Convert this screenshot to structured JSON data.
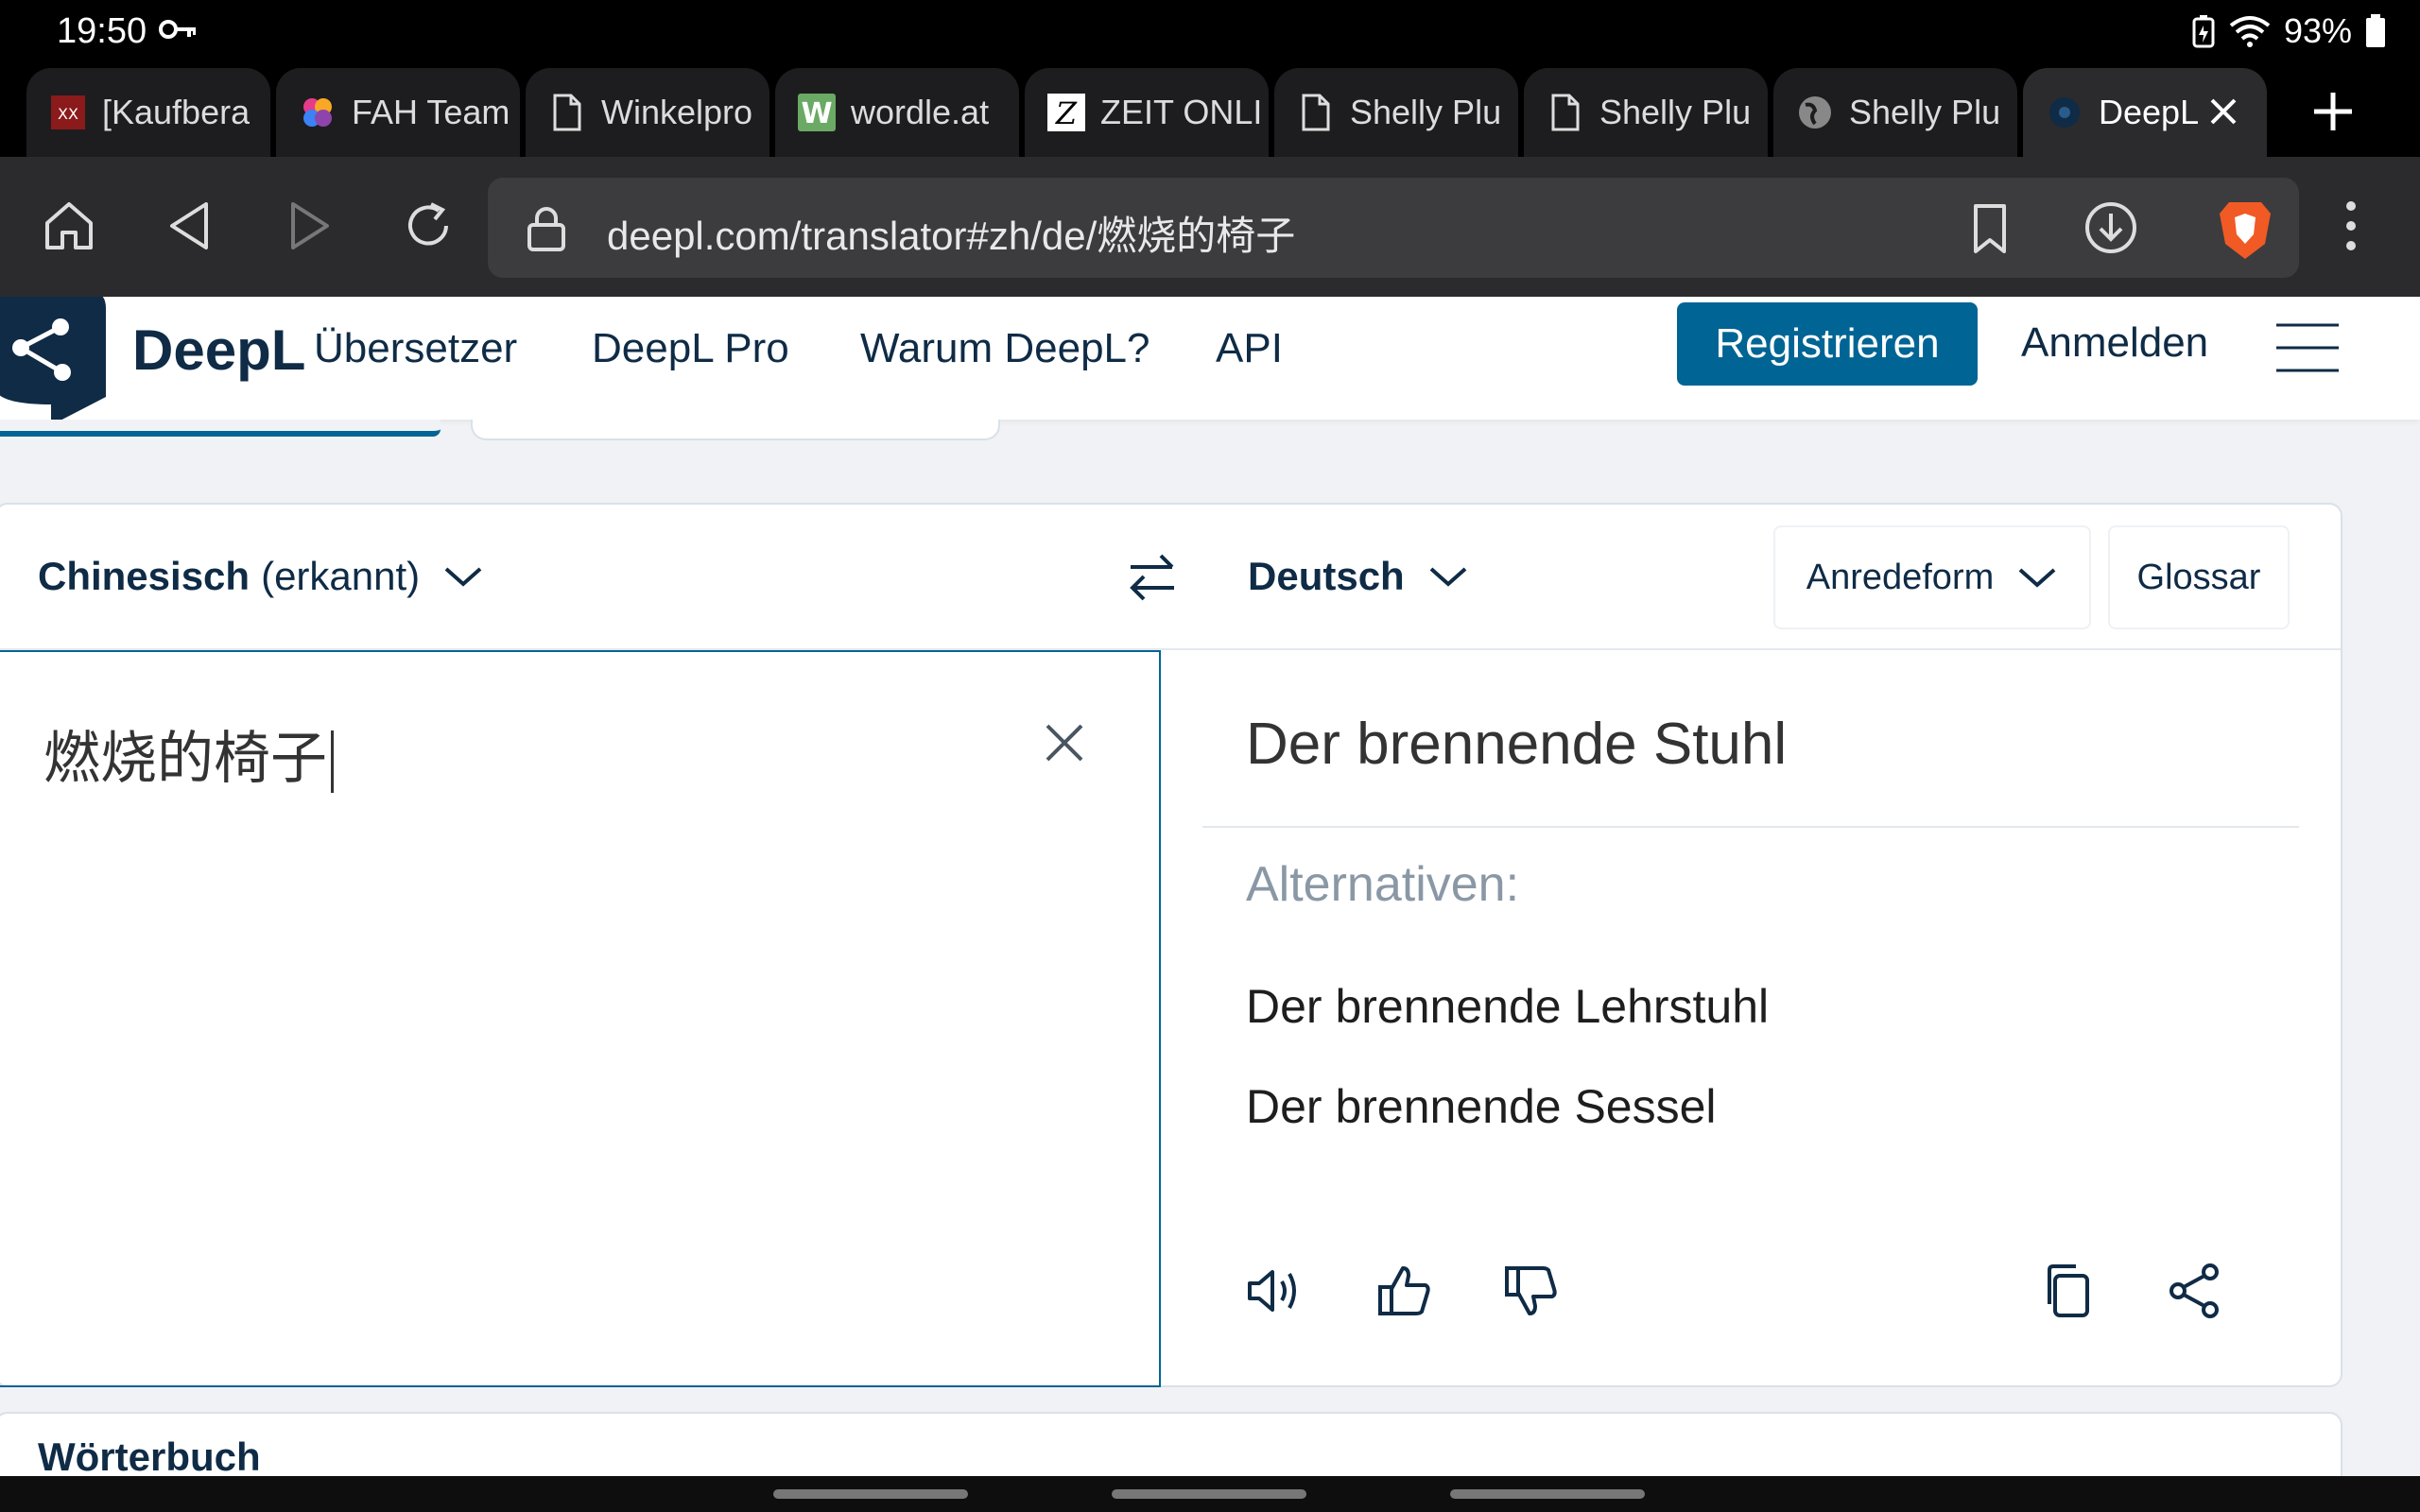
{
  "status_bar": {
    "time": "19:50",
    "battery": "93%"
  },
  "tabs": [
    {
      "label": "[Kaufbera",
      "icon": "shield-red-icon",
      "active": false
    },
    {
      "label": "FAH Team",
      "icon": "fah-icon",
      "active": false
    },
    {
      "label": "Winkelpro",
      "icon": "document-icon",
      "active": false
    },
    {
      "label": "wordle.at",
      "icon": "wordle-icon",
      "active": false
    },
    {
      "label": "ZEIT ONLI",
      "icon": "zeit-icon",
      "active": false
    },
    {
      "label": "Shelly Plu",
      "icon": "document-icon",
      "active": false
    },
    {
      "label": "Shelly Plu",
      "icon": "document-icon",
      "active": false
    },
    {
      "label": "Shelly Plu",
      "icon": "globe-icon",
      "active": false
    },
    {
      "label": "DeepL",
      "icon": "deepl-icon",
      "active": true
    }
  ],
  "address_bar": {
    "url": "deepl.com/translator#zh/de/燃烧的椅子"
  },
  "header": {
    "brand": "DeepL",
    "brand_sub": "Übersetzer",
    "nav": [
      "DeepL Pro",
      "Warum DeepL?",
      "API"
    ],
    "register": "Registrieren",
    "login": "Anmelden"
  },
  "translator": {
    "source_lang": "Chinesisch",
    "source_detected": "(erkannt)",
    "target_lang": "Deutsch",
    "formality_button": "Anredeform",
    "glossary_button": "Glossar",
    "source_text": "燃烧的椅子",
    "target_text": "Der brennende Stuhl",
    "alternatives_label": "Alternativen:",
    "alternatives": [
      "Der brennende Lehrstuhl",
      "Der brennende Sessel"
    ]
  },
  "lower_card": {
    "title": "Wörterbuch"
  },
  "colors": {
    "accent": "#006494",
    "navy": "#0f2b46",
    "brave": "#f15a24"
  }
}
